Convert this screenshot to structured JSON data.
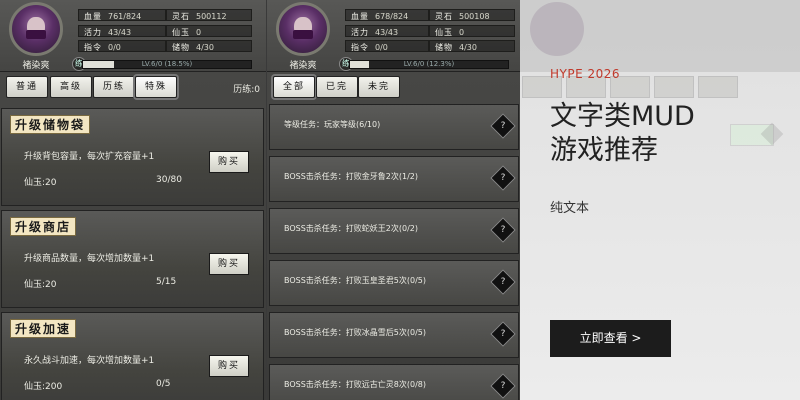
{
  "shop_panel": {
    "player": {
      "name": "褚染爽",
      "stats": [
        {
          "label": "血量",
          "value": "761/824"
        },
        {
          "label": "活力",
          "value": "43/43"
        },
        {
          "label": "指令",
          "value": "0/0"
        }
      ],
      "stats2": [
        {
          "label": "灵石",
          "value": "500112"
        },
        {
          "label": "仙玉",
          "value": "0"
        },
        {
          "label": "储物",
          "value": "4/30"
        }
      ],
      "level_text": "LV.6/0 (18.5%)",
      "level_progress": 0.185,
      "lv_icon": "练"
    },
    "tabs": [
      "普通",
      "高级",
      "历练",
      "特殊"
    ],
    "active_tab": 3,
    "exp_label": "历练:0",
    "items": [
      {
        "title": "升级储物袋",
        "desc": "升级背包容量，每次扩充容量+1",
        "currency": "仙玉:20",
        "count": "30/80",
        "buy": "购买"
      },
      {
        "title": "升级商店",
        "desc": "升级商品数量，每次增加数量+1",
        "currency": "仙玉:20",
        "count": "5/15",
        "buy": "购买"
      },
      {
        "title": "升级加速",
        "desc": "永久战斗加速，每次增加数量+1",
        "currency": "仙玉:200",
        "count": "0/5",
        "buy": "购买"
      }
    ]
  },
  "quest_panel": {
    "player": {
      "name": "褚染爽",
      "stats": [
        {
          "label": "血量",
          "value": "678/824"
        },
        {
          "label": "活力",
          "value": "43/43"
        },
        {
          "label": "指令",
          "value": "0/0"
        }
      ],
      "stats2": [
        {
          "label": "灵石",
          "value": "500108"
        },
        {
          "label": "仙玉",
          "value": "0"
        },
        {
          "label": "储物",
          "value": "4/30"
        }
      ],
      "level_text": "LV.6/0 (12.3%)",
      "level_progress": 0.123,
      "lv_icon": "练"
    },
    "tabs": [
      "全部",
      "已完",
      "未完"
    ],
    "active_tab": 0,
    "quests": [
      {
        "text": "等级任务：玩家等级(6/10)",
        "icon": "?"
      },
      {
        "text": "BOSS击杀任务：打败金牙鲁2次(1/2)",
        "icon": "?"
      },
      {
        "text": "BOSS击杀任务：打败蛇妖王2次(0/2)",
        "icon": "?"
      },
      {
        "text": "BOSS击杀任务：打败玉皇圣君5次(0/5)",
        "icon": "?"
      },
      {
        "text": "BOSS击杀任务：打败冰晶雪后5次(0/5)",
        "icon": "?"
      },
      {
        "text": "BOSS击杀任务：打败远古亡灵8次(0/8)",
        "icon": "?"
      }
    ]
  },
  "promo": {
    "brand": "HYPE 2026",
    "headline": "文字类MUD游戏推荐",
    "subtitle": "纯文本",
    "cta": "立即查看 >"
  }
}
